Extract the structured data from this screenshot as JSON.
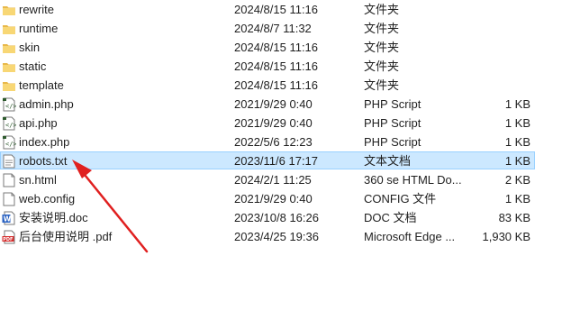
{
  "files": [
    {
      "name": "rewrite",
      "date": "2024/8/15 11:16",
      "type": "文件夹",
      "size": "",
      "icon": "folder-icon"
    },
    {
      "name": "runtime",
      "date": "2024/8/7 11:32",
      "type": "文件夹",
      "size": "",
      "icon": "folder-icon"
    },
    {
      "name": "skin",
      "date": "2024/8/15 11:16",
      "type": "文件夹",
      "size": "",
      "icon": "folder-icon"
    },
    {
      "name": "static",
      "date": "2024/8/15 11:16",
      "type": "文件夹",
      "size": "",
      "icon": "folder-icon"
    },
    {
      "name": "template",
      "date": "2024/8/15 11:16",
      "type": "文件夹",
      "size": "",
      "icon": "folder-icon"
    },
    {
      "name": "admin.php",
      "date": "2021/9/29 0:40",
      "type": "PHP Script",
      "size": "1 KB",
      "icon": "php-file-icon"
    },
    {
      "name": "api.php",
      "date": "2021/9/29 0:40",
      "type": "PHP Script",
      "size": "1 KB",
      "icon": "php-file-icon"
    },
    {
      "name": "index.php",
      "date": "2022/5/6 12:23",
      "type": "PHP Script",
      "size": "1 KB",
      "icon": "php-file-icon"
    },
    {
      "name": "robots.txt",
      "date": "2023/11/6 17:17",
      "type": "文本文档",
      "size": "1 KB",
      "icon": "text-file-icon",
      "selected": true
    },
    {
      "name": "sn.html",
      "date": "2024/2/1 11:25",
      "type": "360 se HTML Do...",
      "size": "2 KB",
      "icon": "html-file-icon"
    },
    {
      "name": "web.config",
      "date": "2021/9/29 0:40",
      "type": "CONFIG 文件",
      "size": "1 KB",
      "icon": "config-file-icon"
    },
    {
      "name": "安装说明.doc",
      "date": "2023/10/8 16:26",
      "type": "DOC 文档",
      "size": "83 KB",
      "icon": "word-doc-icon"
    },
    {
      "name": "后台使用说明 .pdf",
      "date": "2023/4/25 19:36",
      "type": "Microsoft Edge ...",
      "size": "1,930 KB",
      "icon": "pdf-file-icon"
    }
  ],
  "colors": {
    "selection_bg": "#cce8ff",
    "selection_border": "#99d1ff",
    "folder": "#f8d775",
    "arrow": "#e02020"
  },
  "annotation": {
    "icon": "red-arrow-pointer"
  }
}
